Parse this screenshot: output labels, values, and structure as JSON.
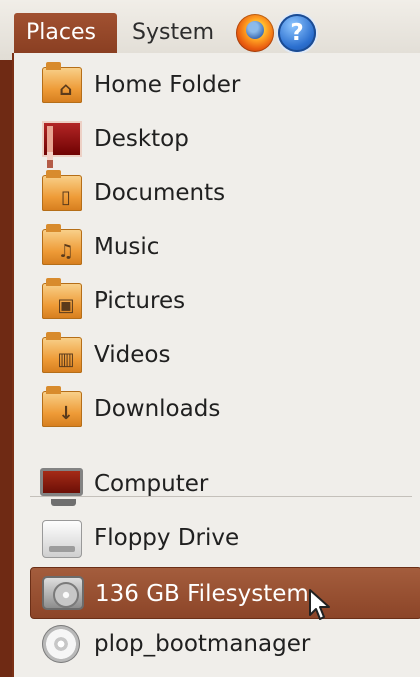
{
  "panel": {
    "places_label": "Places",
    "system_label": "System",
    "help_label": "?"
  },
  "places_menu": {
    "items": [
      {
        "label": "Home Folder",
        "icon": "home-folder-icon"
      },
      {
        "label": "Desktop",
        "icon": "desktop-icon"
      },
      {
        "label": "Documents",
        "icon": "documents-folder-icon"
      },
      {
        "label": "Music",
        "icon": "music-folder-icon"
      },
      {
        "label": "Pictures",
        "icon": "pictures-folder-icon"
      },
      {
        "label": "Videos",
        "icon": "videos-folder-icon"
      },
      {
        "label": "Downloads",
        "icon": "downloads-folder-icon"
      },
      {
        "label": "Computer",
        "icon": "computer-icon"
      },
      {
        "label": "Floppy Drive",
        "icon": "floppy-drive-icon"
      },
      {
        "label": "136 GB Filesystem",
        "icon": "hard-drive-icon"
      },
      {
        "label": "plop_bootmanager",
        "icon": "cd-icon"
      }
    ],
    "selected_label": "136 GB Filesystem"
  },
  "colors": {
    "panel_active": "#9a4b2f",
    "selected_row": "#954d31",
    "menu_background": "#f0eeea"
  }
}
